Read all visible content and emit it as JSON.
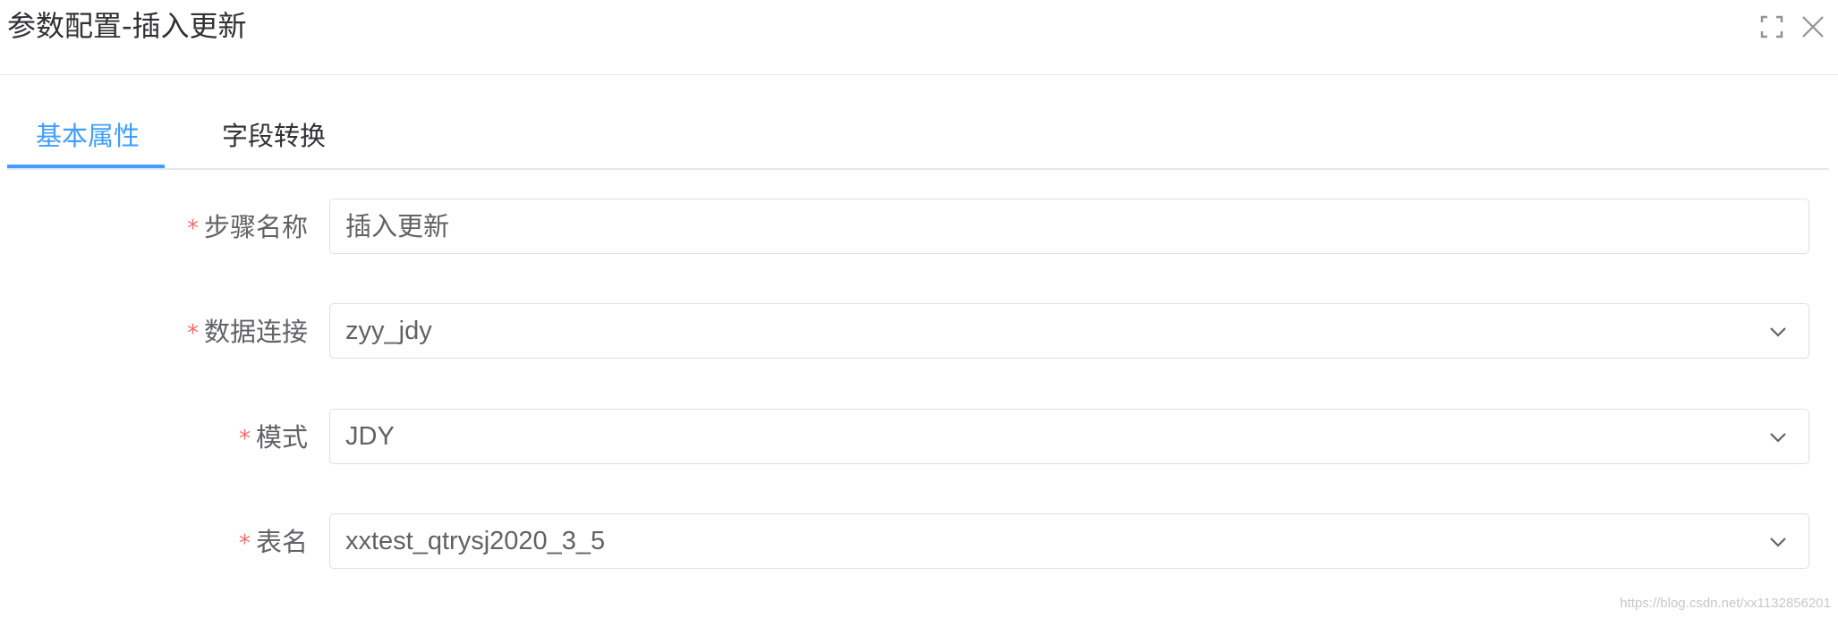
{
  "dialog": {
    "title": "参数配置-插入更新",
    "fullscreen_icon": "fullscreen-icon",
    "close_icon": "close-icon"
  },
  "tabs": [
    {
      "label": "基本属性",
      "active": true
    },
    {
      "label": "字段转换",
      "active": false
    }
  ],
  "form": {
    "required_mark": "*",
    "step_name": {
      "label": "步骤名称",
      "value": "插入更新"
    },
    "connection": {
      "label": "数据连接",
      "value": "zyy_jdy",
      "icon": "chevron-down-icon"
    },
    "schema": {
      "label": "模式",
      "value": "JDY",
      "icon": "chevron-down-icon"
    },
    "table": {
      "label": "表名",
      "value": "xxtest_qtrysj2020_3_5",
      "icon": "chevron-down-icon"
    }
  },
  "watermark": "https://blog.csdn.net/xx1132856201",
  "colors": {
    "accent": "#409eff",
    "required": "#f56c6c",
    "border": "#dcdfe6",
    "text": "#606266"
  }
}
